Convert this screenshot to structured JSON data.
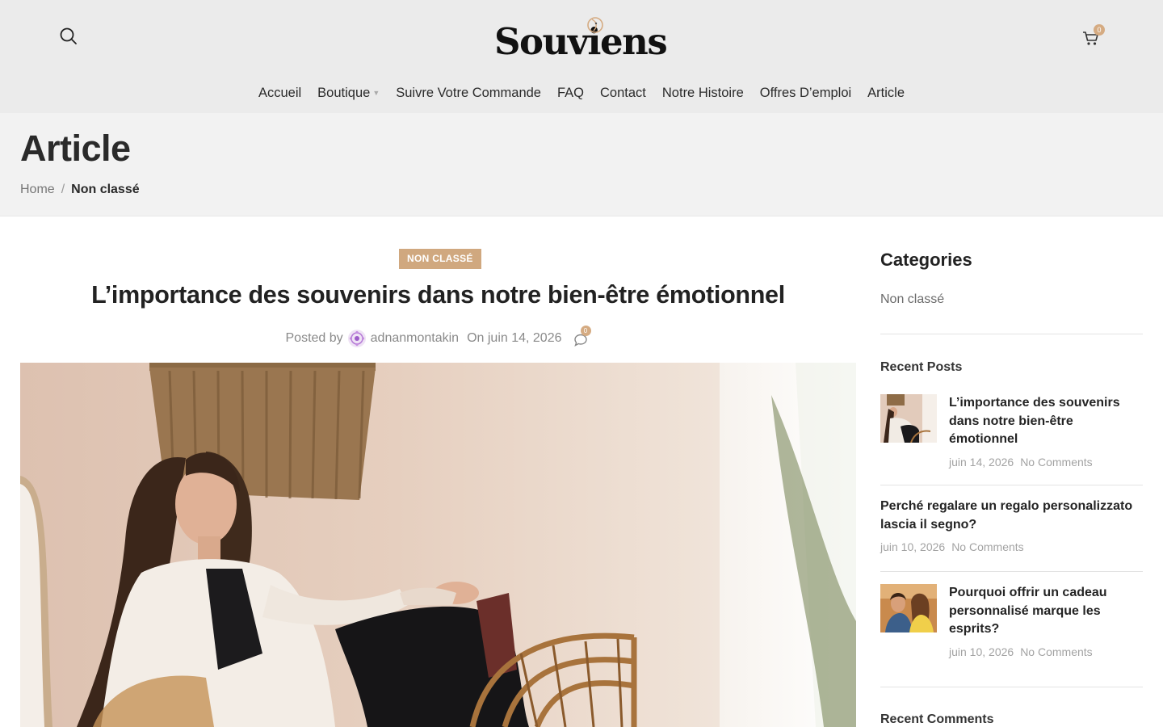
{
  "header": {
    "logo_text": "Souviens",
    "cart_count": "0",
    "nav": [
      {
        "label": "Accueil"
      },
      {
        "label": "Boutique"
      },
      {
        "label": "Suivre Votre Commande"
      },
      {
        "label": "FAQ"
      },
      {
        "label": "Contact"
      },
      {
        "label": "Notre Histoire"
      },
      {
        "label": "Offres D’emploi"
      },
      {
        "label": "Article"
      }
    ]
  },
  "page": {
    "title": "Article",
    "breadcrumb_home": "Home",
    "breadcrumb_sep": "/",
    "breadcrumb_current": "Non classé"
  },
  "post": {
    "category": "NON CLASSÉ",
    "title": "L’importance des souvenirs dans notre bien-être émotionnel",
    "posted_by": "Posted by",
    "author": "adnanmontakin",
    "date": "On juin 14, 2026",
    "comment_count": "0"
  },
  "sidebar": {
    "categories_heading": "Categories",
    "categories": [
      "Non classé"
    ],
    "recent_posts_heading": "Recent Posts",
    "recent_posts": [
      {
        "title": "L’importance des souvenirs dans notre bien-être émotionnel",
        "date": "juin 14, 2026",
        "comments": "No Comments"
      },
      {
        "title": "Perché regalare un regalo personalizzato lascia il segno?",
        "date": "juin 10, 2026",
        "comments": "No Comments"
      },
      {
        "title": "Pourquoi offrir un cadeau personnalisé marque les esprits?",
        "date": "juin 10, 2026",
        "comments": "No Comments"
      }
    ],
    "recent_comments_heading": "Recent Comments"
  },
  "colors": {
    "accent": "#d0a87f",
    "header_bg": "#ebebeb",
    "title_band_bg": "#f2f2f2"
  }
}
